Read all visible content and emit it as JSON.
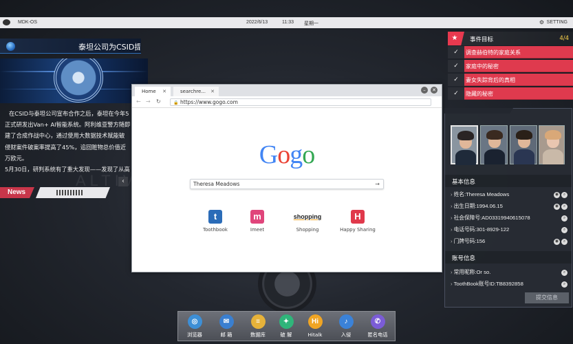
{
  "topbar": {
    "os": "MDK-OS",
    "date": "2022/6/13",
    "time": "11:33",
    "weekday": "星期一",
    "setting": "SETTING"
  },
  "news": {
    "title": "泰坦公司为CSID提",
    "paragraphs": [
      "在CSID与泰坦公司宣布合作之后，泰坦在今年5",
      "正式研发出Van+ AI智能系统。阿利维亚警方随即",
      "建了合成作战中心，通过使用大数据技术赋能破",
      "侵财案件破案率提高了45%，追回赃物总价值近",
      "万欧元。",
      "5月30日，研判系统有了重大发现——发现了从高"
    ],
    "label": "News",
    "bg_word": "ALTIV"
  },
  "browser": {
    "tabs": [
      {
        "label": "Home"
      },
      {
        "label": "searchre..."
      }
    ],
    "url": "https://www.gogo.com",
    "logo_letters": [
      "G",
      "o",
      "g",
      "o"
    ],
    "logo_colors": [
      "#4285f4",
      "#ea4335",
      "#4285f4",
      "#34a853"
    ],
    "search_value": "Theresa Meadows",
    "shortcuts": [
      {
        "label": "Toothbook",
        "glyph": "t",
        "color": "#2b6cb8"
      },
      {
        "label": "Imeet",
        "glyph": "m",
        "color": "#e0457b"
      },
      {
        "label": "Shopping",
        "glyph": "shopping",
        "color": "#222222"
      },
      {
        "label": "Happy Sharing",
        "glyph": "H",
        "color": "#e0394b"
      }
    ]
  },
  "mission": {
    "title": "事件目标",
    "count": "4/4",
    "items": [
      "调查赫伯特的家庭关系",
      "家庭中的秘密",
      "妻女失踪背后的真相",
      "隐藏的秘密"
    ]
  },
  "info": {
    "basic_title": "基本信息",
    "basic": [
      {
        "text": "姓名:Theresa Meadows",
        "buttons": 2
      },
      {
        "text": "出生日期:1994.06.15",
        "buttons": 2
      },
      {
        "text": "社会保障号:AD03319940615078",
        "buttons": 1
      },
      {
        "text": "电话号码:301-8929-122",
        "buttons": 1
      },
      {
        "text": "门牌号码:156",
        "buttons": 2
      }
    ],
    "account_title": "账号信息",
    "account": [
      {
        "text": "常用昵称:Or so.",
        "buttons": 1
      },
      {
        "text": "ToothBook账号ID:TB8392858",
        "buttons": 1
      }
    ],
    "submit": "提交信息"
  },
  "dock": [
    {
      "label": "浏览器",
      "color": "#3d8fd6",
      "glyph": "◎"
    },
    {
      "label": "邮 箱",
      "color": "#3a7fd0",
      "glyph": "✉"
    },
    {
      "label": "数据库",
      "color": "#e6b23a",
      "glyph": "≡"
    },
    {
      "label": "破 解",
      "color": "#2fb57a",
      "glyph": "✦"
    },
    {
      "label": "Hitalk",
      "color": "#f0a524",
      "glyph": "Hi"
    },
    {
      "label": "入侵",
      "color": "#3b82d8",
      "glyph": "♪"
    },
    {
      "label": "匿名电话",
      "color": "#7b5cd6",
      "glyph": "✆"
    }
  ]
}
